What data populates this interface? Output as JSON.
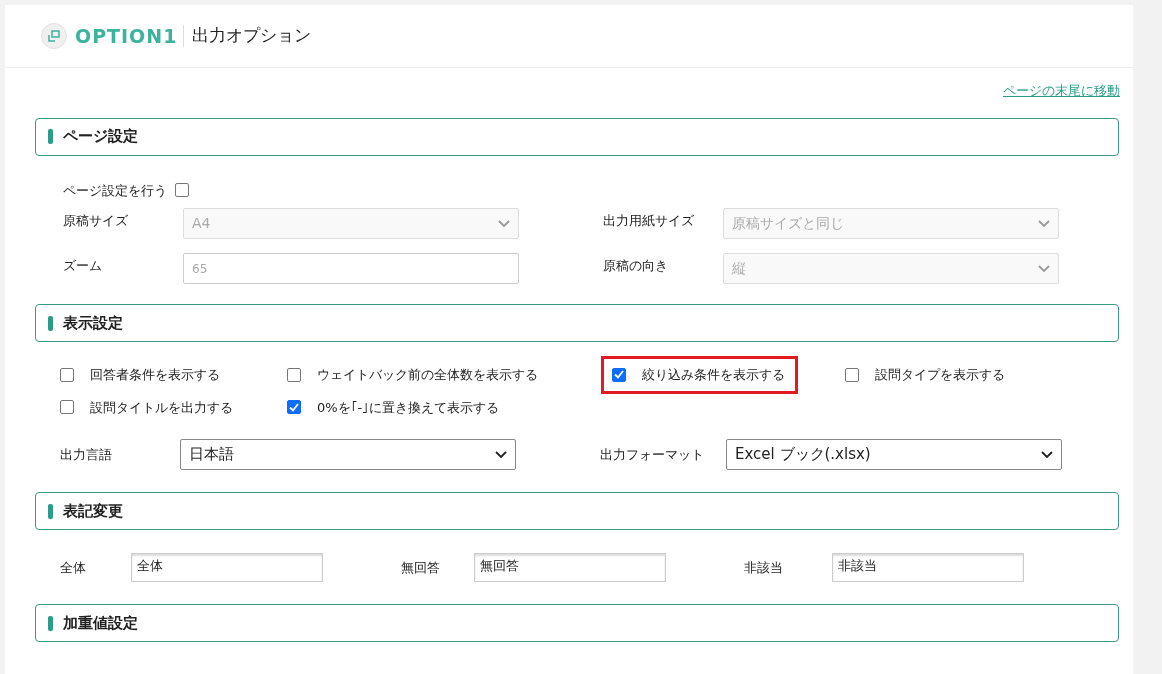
{
  "header": {
    "logo_text": "OPTION1",
    "title": "出力オプション"
  },
  "jump_link": "ページの末尾に移動",
  "page_settings": {
    "title": "ページ設定",
    "enable": {
      "label": "ページ設定を行う",
      "checked": false
    },
    "fields": [
      {
        "label": "原稿サイズ",
        "kind": "select",
        "value": "A4",
        "disabled": true
      },
      {
        "label": "出力用紙サイズ",
        "kind": "select",
        "value": "原稿サイズと同じ",
        "disabled": true
      },
      {
        "label": "ズーム",
        "kind": "input",
        "value": "65",
        "disabled": false
      },
      {
        "label": "原稿の向き",
        "kind": "select",
        "value": "縦",
        "disabled": true
      }
    ]
  },
  "display_settings": {
    "title": "表示設定",
    "options": [
      {
        "label": "回答者条件を表示する",
        "checked": false,
        "highlighted": false
      },
      {
        "label": "ウェイトバック前の全体数を表示する",
        "checked": false,
        "highlighted": false
      },
      {
        "label": "絞り込み条件を表示する",
        "checked": true,
        "highlighted": true
      },
      {
        "label": "設問タイプを表示する",
        "checked": false,
        "highlighted": false
      },
      {
        "label": "設問タイトルを出力する",
        "checked": false,
        "highlighted": false
      },
      {
        "label": "0%を｢-｣に置き換えて表示する",
        "checked": true,
        "highlighted": false
      }
    ],
    "selects": [
      {
        "label": "出力言語",
        "value": "日本語"
      },
      {
        "label": "出力フォーマット",
        "value": "Excel ブック(.xlsx)"
      }
    ]
  },
  "notation": {
    "title": "表記変更",
    "fields": [
      {
        "label": "全体",
        "value": "全体"
      },
      {
        "label": "無回答",
        "value": "無回答"
      },
      {
        "label": "非該当",
        "value": "非該当"
      }
    ]
  },
  "weight": {
    "title": "加重値設定"
  }
}
